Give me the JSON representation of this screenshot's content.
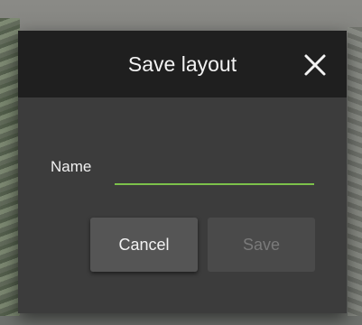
{
  "dialog": {
    "title": "Save layout",
    "close_icon": "close-icon",
    "name_label": "Name",
    "name_value": "",
    "cancel_label": "Cancel",
    "save_label": "Save"
  },
  "colors": {
    "titlebar": "#1f1f1f",
    "dialog_body": "#3c3c3c",
    "input_underline": "#7cc14a",
    "save_disabled_text": "#7a7a7a"
  }
}
